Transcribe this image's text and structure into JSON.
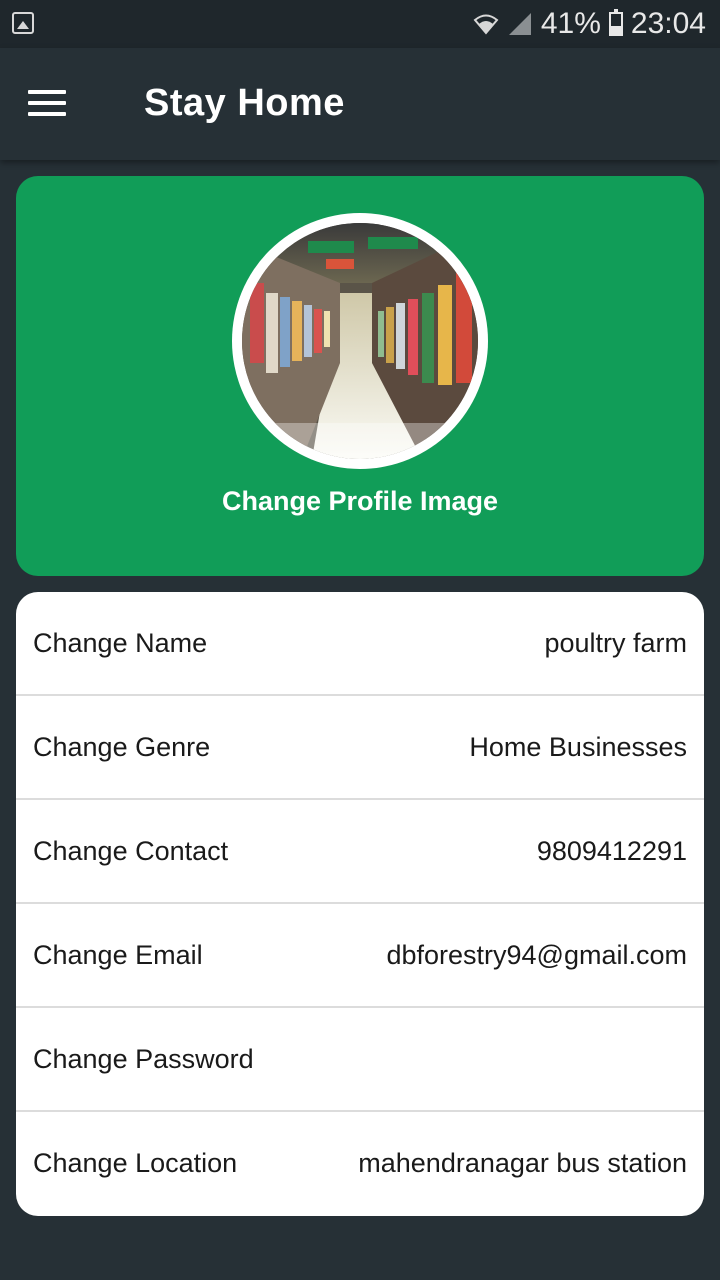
{
  "status_bar": {
    "battery": "41%",
    "time": "23:04"
  },
  "app_bar": {
    "title": "Stay Home"
  },
  "profile": {
    "change_image_label": "Change Profile Image"
  },
  "settings": {
    "rows": [
      {
        "label": "Change Name",
        "value": "poultry farm"
      },
      {
        "label": "Change Genre",
        "value": "Home Businesses"
      },
      {
        "label": "Change Contact",
        "value": "9809412291"
      },
      {
        "label": "Change Email",
        "value": "dbforestry94@gmail.com"
      },
      {
        "label": "Change Password",
        "value": ""
      },
      {
        "label": "Change Location",
        "value": "mahendranagar bus station"
      }
    ]
  },
  "colors": {
    "background": "#263036",
    "accent_green": "#119d58",
    "card": "#ffffff"
  },
  "icons": {
    "gallery": "image-icon",
    "wifi": "wifi-icon",
    "signal": "signal-icon",
    "battery": "battery-icon",
    "menu": "hamburger-menu-icon"
  }
}
